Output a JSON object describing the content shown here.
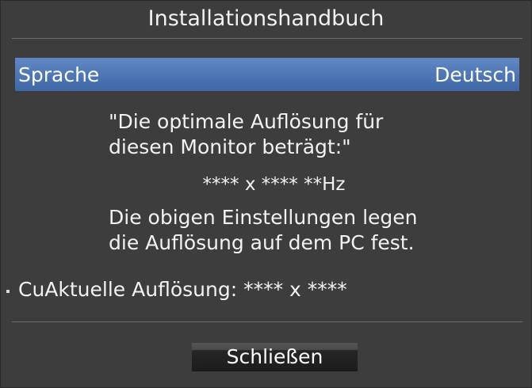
{
  "dialog": {
    "title": "Installationshandbuch"
  },
  "language": {
    "label": "Sprache",
    "value": "Deutsch"
  },
  "message": {
    "line1": "\"Die optimale Auflösung für",
    "line2": "diesen Monitor beträgt:\"",
    "resolution": "**** x **** **Hz",
    "line3": "Die obigen Einstellungen legen",
    "line4": "die Auflösung auf dem PC fest."
  },
  "current": {
    "text": "CuAktuelle Auflösung: **** x ****"
  },
  "buttons": {
    "close_label": "Schließen"
  },
  "colors": {
    "background": "#3d3d3d",
    "highlight": "#4f78b6",
    "text": "#ffffff"
  }
}
